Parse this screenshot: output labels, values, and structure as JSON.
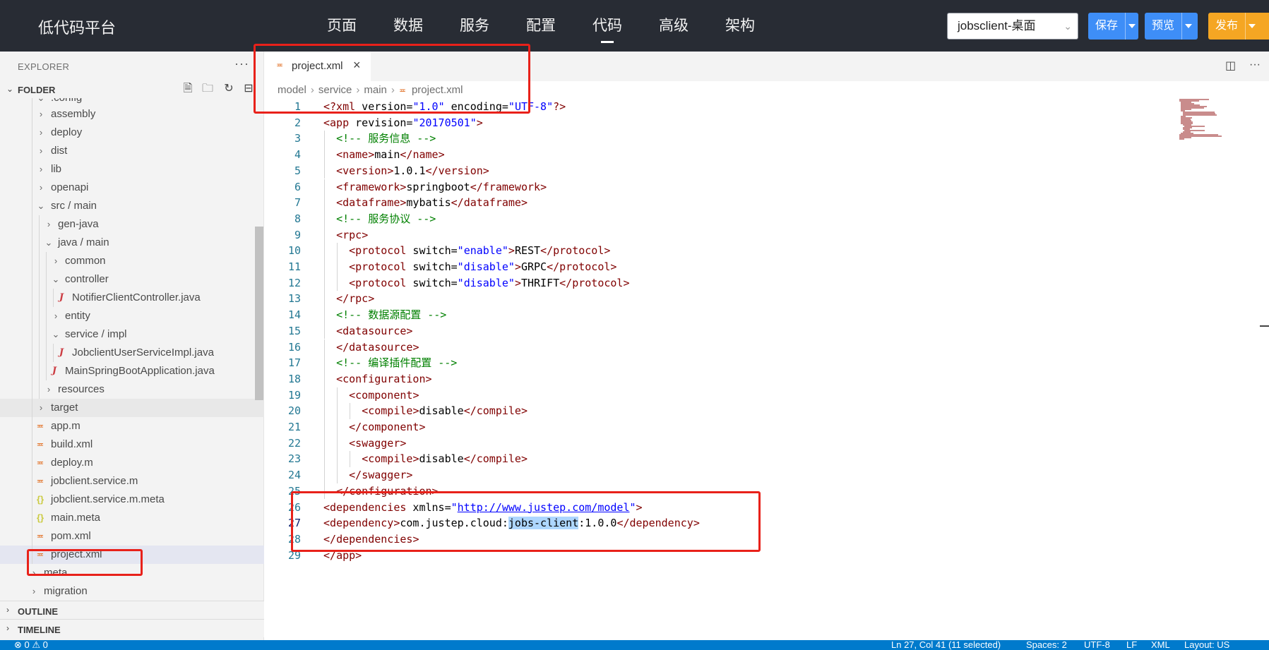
{
  "brand": "低代码平台",
  "nav": [
    "页面",
    "数据",
    "服务",
    "配置",
    "代码",
    "高级",
    "架构"
  ],
  "project_select": "jobsclient-桌面",
  "buttons": {
    "save": "保存",
    "preview": "预览",
    "publish": "发布"
  },
  "sidebar": {
    "explorer": "EXPLORER",
    "folder": "FOLDER",
    "outline": "OUTLINE",
    "timeline": "TIMELINE",
    "tree": [
      ".config",
      "assembly",
      "deploy",
      "dist",
      "lib",
      "openapi",
      "src / main",
      "gen-java",
      "java / main",
      "common",
      "controller",
      "NotifierClientController.java",
      "entity",
      "service / impl",
      "JobclientUserServiceImpl.java",
      "MainSpringBootApplication.java",
      "resources",
      "target",
      "app.m",
      "build.xml",
      "deploy.m",
      "jobclient.service.m",
      "jobclient.service.m.meta",
      "main.meta",
      "pom.xml",
      "project.xml",
      "meta",
      "migration"
    ]
  },
  "tab": {
    "label": "project.xml"
  },
  "breadcrumb": [
    "model",
    "service",
    "main",
    "project.xml"
  ],
  "code": [
    "<?xml version=\"1.0\" encoding=\"UTF-8\"?>",
    "<app revision=\"20170501\">",
    "  <!-- 服务信息 -->",
    "  <name>main</name>",
    "  <version>1.0.1</version>",
    "  <framework>springboot</framework>",
    "  <dataframe>mybatis</dataframe>",
    "  <!-- 服务协议 -->",
    "  <rpc>",
    "    <protocol switch=\"enable\">REST</protocol>",
    "    <protocol switch=\"disable\">GRPC</protocol>",
    "    <protocol switch=\"disable\">THRIFT</protocol>",
    "  </rpc>",
    "  <!-- 数据源配置 -->",
    "  <datasource>",
    "  </datasource>",
    "  <!-- 编译插件配置 -->",
    "  <configuration>",
    "    <component>",
    "      <compile>disable</compile>",
    "    </component>",
    "    <swagger>",
    "      <compile>disable</compile>",
    "    </swagger>",
    "  </configuration>",
    "<dependencies xmlns=\"http://www.justep.com/model\">",
    "<dependency>com.justep.cloud:jobs-client:1.0.0</dependency>",
    "</dependencies>",
    "</app>"
  ],
  "status": {
    "problems": "⊗ 0 ⚠ 0",
    "position": "Ln 27, Col 41 (11 selected)",
    "spaces": "Spaces: 2",
    "encoding": "UTF-8",
    "eol": "LF",
    "language": "XML",
    "layout": "Layout: US"
  },
  "icons": {
    "xml": "rss-icon",
    "java": "java-icon",
    "json": "braces-icon",
    "new-file": "new-file-icon",
    "new-folder": "new-folder-icon",
    "refresh": "refresh-icon",
    "collapse": "collapse-icon"
  },
  "colors": {
    "topbar": "#282c34",
    "primary": "#3e8ef7",
    "publish": "#f5a623",
    "status": "#007acc",
    "annotation": "#e8211a"
  }
}
